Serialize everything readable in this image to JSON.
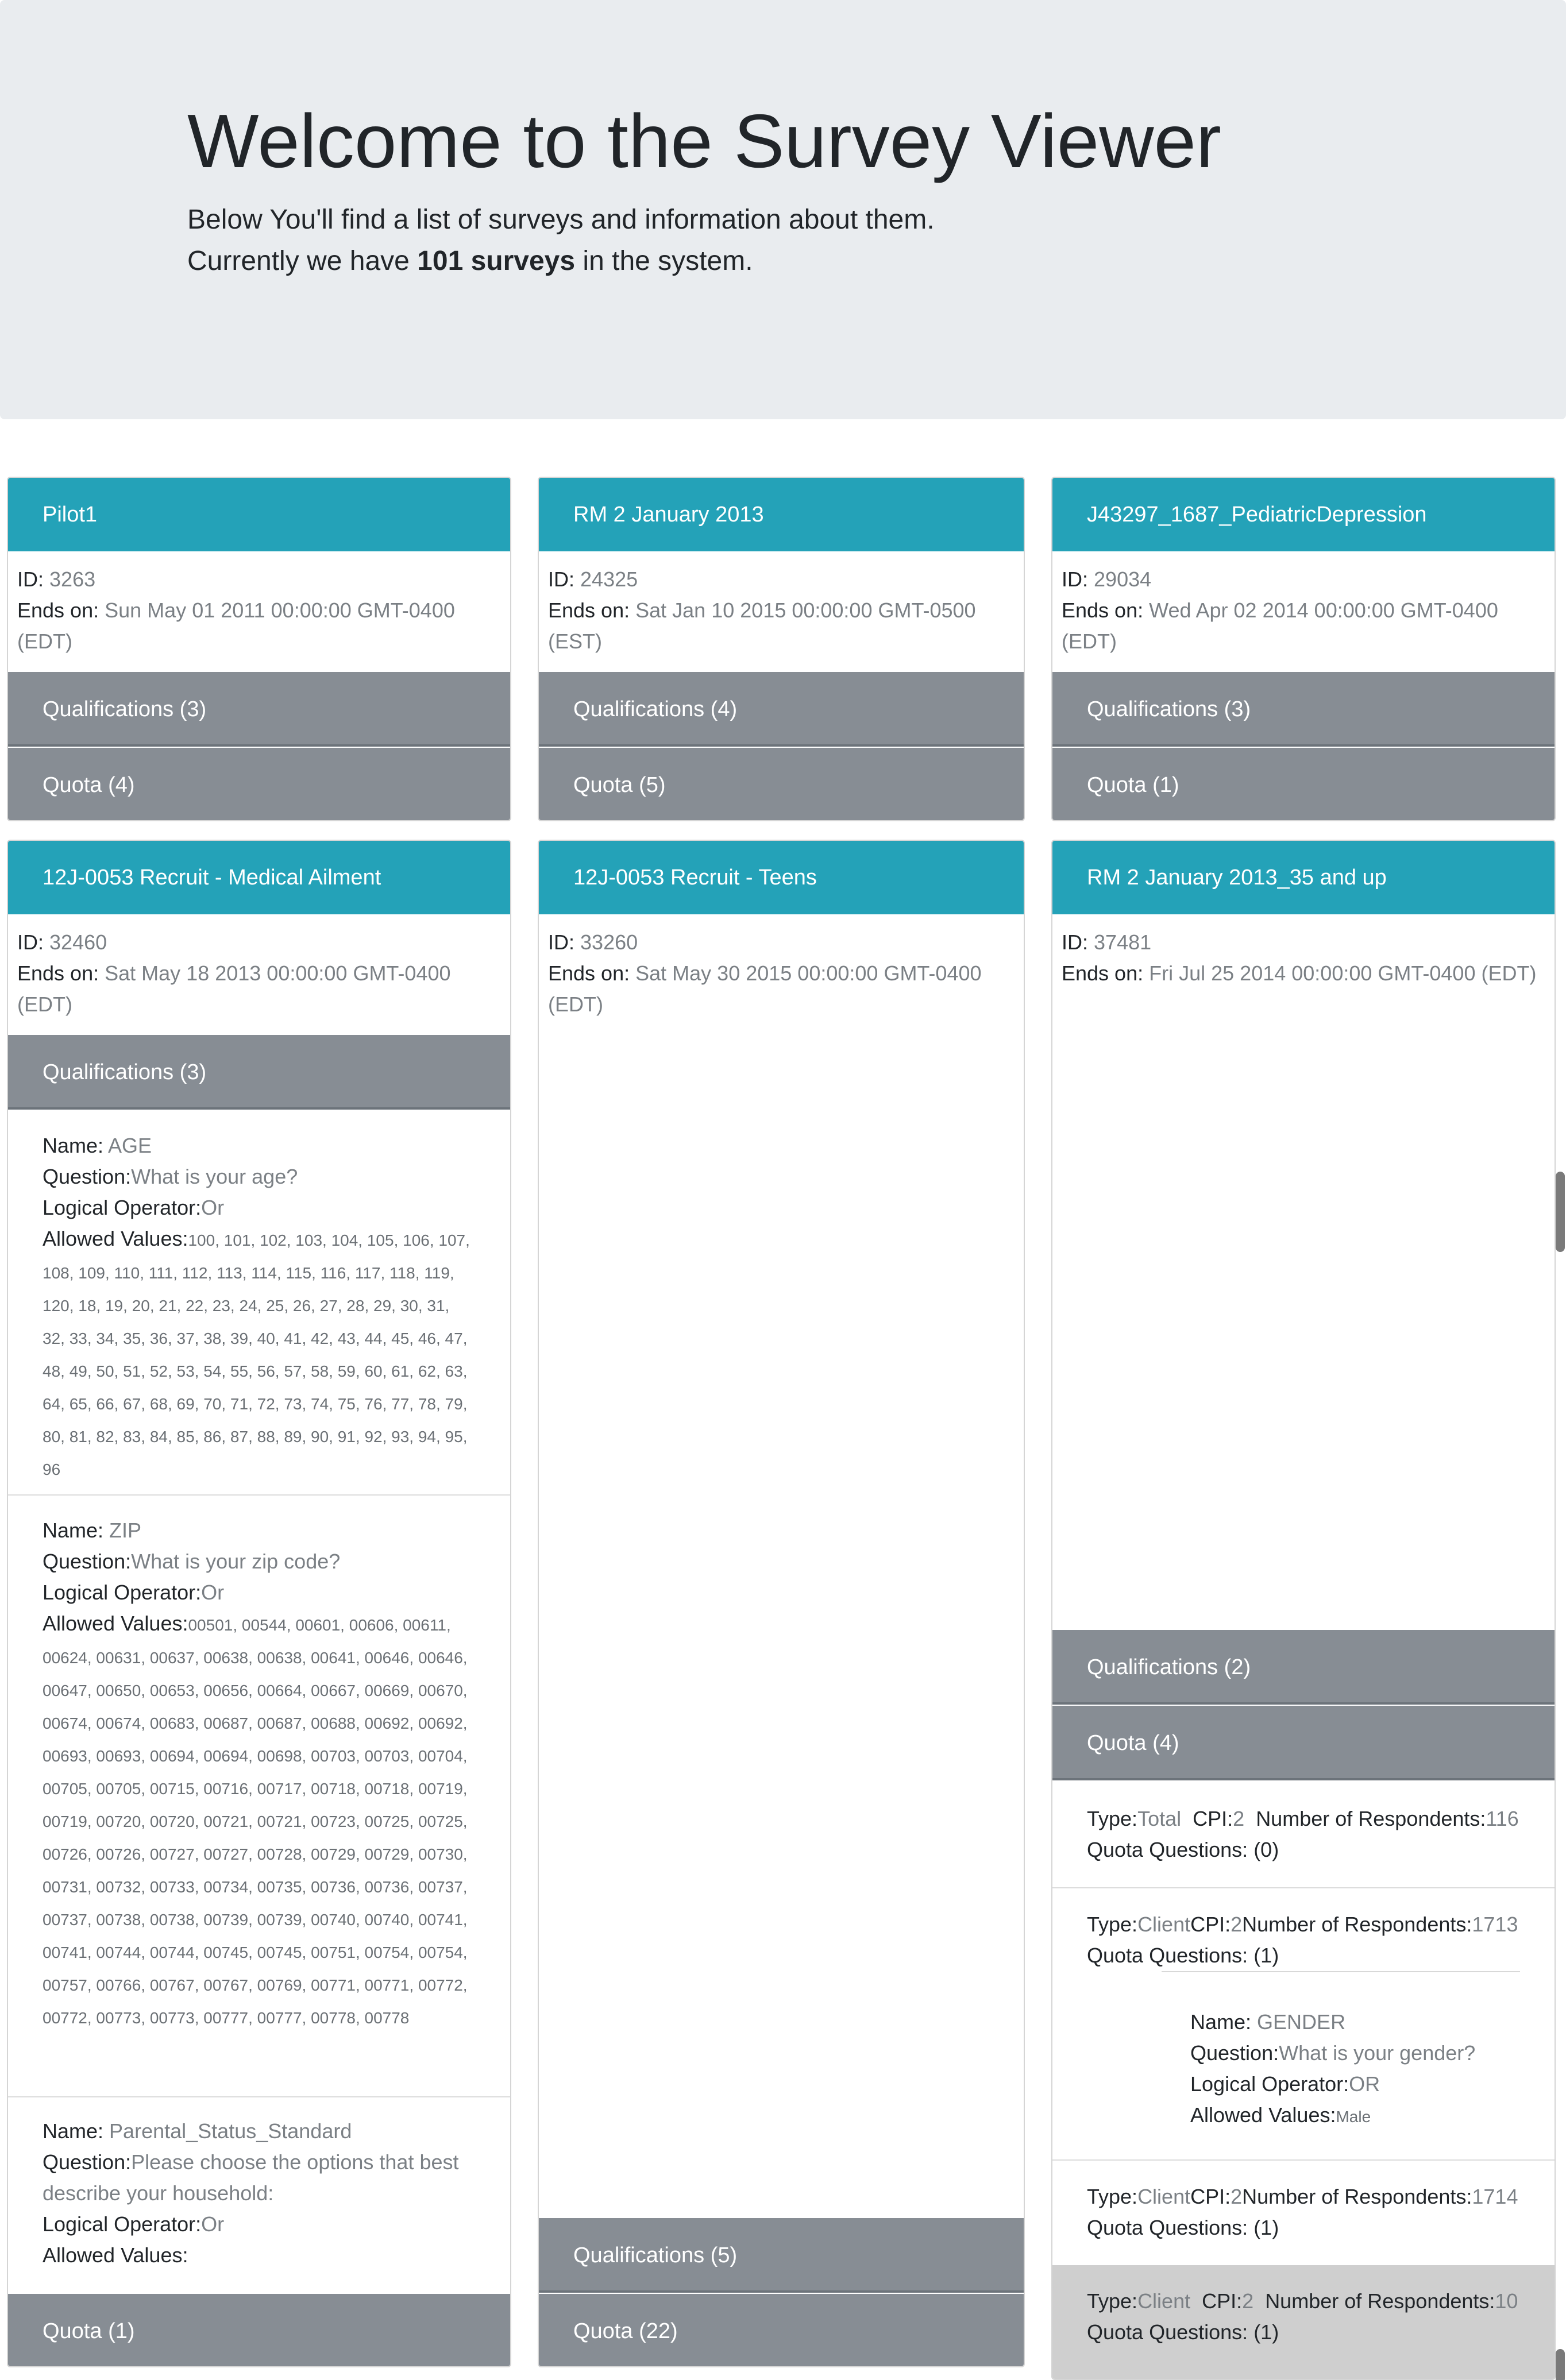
{
  "jumbotron": {
    "title": "Welcome to the Survey Viewer",
    "line1": "Below You'll find a list of surveys and information about them.",
    "line2_prefix": "Currently we have ",
    "line2_bold": "101 surveys",
    "line2_suffix": " in the system."
  },
  "labels": {
    "id": "ID:",
    "ends_on": "Ends on:",
    "name": "Name:",
    "question": "Question:",
    "logical_operator": "Logical Operator:",
    "allowed_values": "Allowed Values:",
    "type": "Type:",
    "cpi": "CPI:",
    "respondents": "Number of Respondents:",
    "quota_questions": "Quota Questions:"
  },
  "surveys": [
    {
      "title": "Pilot1",
      "id": "3263",
      "ends_on": "Sun May 01 2011 00:00:00 GMT-0400 (EDT)",
      "qualifications": "Qualifications (3)",
      "quota": "Quota (4)"
    },
    {
      "title": "RM 2 January 2013",
      "id": "24325",
      "ends_on": "Sat Jan 10 2015 00:00:00 GMT-0500 (EST)",
      "qualifications": "Qualifications (4)",
      "quota": "Quota (5)"
    },
    {
      "title": "J43297_1687_PediatricDepression",
      "id": "29034",
      "ends_on": "Wed Apr 02 2014 00:00:00 GMT-0400 (EDT)",
      "qualifications": "Qualifications (3)",
      "quota": "Quota (1)"
    },
    {
      "title": "12J-0053 Recruit - Medical Ailment",
      "id": "32460",
      "ends_on": "Sat May 18 2013 00:00:00 GMT-0400 (EDT)",
      "qualifications": "Qualifications (3)",
      "quota": "Quota (1)",
      "qualification_items": [
        {
          "name": "AGE",
          "question": "What is your age?",
          "operator": "Or",
          "values": "100, 101, 102, 103, 104, 105, 106, 107, 108, 109, 110, 111, 112, 113, 114, 115, 116, 117, 118, 119, 120, 18, 19, 20, 21, 22, 23, 24, 25, 26, 27, 28, 29, 30, 31, 32, 33, 34, 35, 36, 37, 38, 39, 40, 41, 42, 43, 44, 45, 46, 47, 48, 49, 50, 51, 52, 53, 54, 55, 56, 57, 58, 59, 60, 61, 62, 63, 64, 65, 66, 67, 68, 69, 70, 71, 72, 73, 74, 75, 76, 77, 78, 79, 80, 81, 82, 83, 84, 85, 86, 87, 88, 89, 90, 91, 92, 93, 94, 95, 96"
        },
        {
          "name": "ZIP",
          "question": "What is your zip code?",
          "operator": "Or",
          "values": "00501, 00544, 00601, 00606, 00611, 00624, 00631, 00637, 00638, 00638, 00641, 00646, 00646, 00647, 00650, 00653, 00656, 00664, 00667, 00669, 00670, 00674, 00674, 00683, 00687, 00687, 00688, 00692, 00692, 00693, 00693, 00694, 00694, 00698, 00703, 00703, 00704, 00705, 00705, 00715, 00716, 00717, 00718, 00718, 00719, 00719, 00720, 00720, 00721, 00721, 00723, 00725, 00725, 00726, 00726, 00727, 00727, 00728, 00729, 00729, 00730, 00731, 00732, 00733, 00734, 00735, 00736, 00736, 00737, 00737, 00738, 00738, 00739, 00739, 00740, 00740, 00741, 00741, 00744, 00744, 00745, 00745, 00751, 00754, 00754, 00757, 00766, 00767, 00767, 00769, 00771, 00771, 00772, 00772, 00773, 00773, 00777, 00777, 00778, 00778"
        },
        {
          "name": "Parental_Status_Standard",
          "question": "Please choose the options that best describe your household:",
          "operator": "Or",
          "values": ""
        }
      ]
    },
    {
      "title": "12J-0053 Recruit - Teens",
      "id": "33260",
      "ends_on": "Sat May 30 2015 00:00:00 GMT-0400 (EDT)",
      "qualifications": "Qualifications (5)",
      "quota": "Quota (22)"
    },
    {
      "title": "RM 2 January 2013_35 and up",
      "id": "37481",
      "ends_on": "Fri Jul 25 2014 00:00:00 GMT-0400 (EDT)",
      "qualifications": "Qualifications (2)",
      "quota": "Quota (4)",
      "quota_items": [
        {
          "type": "Total",
          "cpi": "2",
          "respondents": "116",
          "questions": "(0)"
        },
        {
          "type": "Client",
          "cpi": "2",
          "respondents": "1713",
          "questions": "(1)",
          "question_detail": {
            "name": "GENDER",
            "question": "What is your gender?",
            "operator": "OR",
            "values": "Male"
          }
        },
        {
          "type": "Client",
          "cpi": "2",
          "respondents": "1714",
          "questions": "(1)"
        },
        {
          "type": "Client",
          "cpi": "2",
          "respondents": "10",
          "questions": "(1)"
        }
      ]
    }
  ]
}
